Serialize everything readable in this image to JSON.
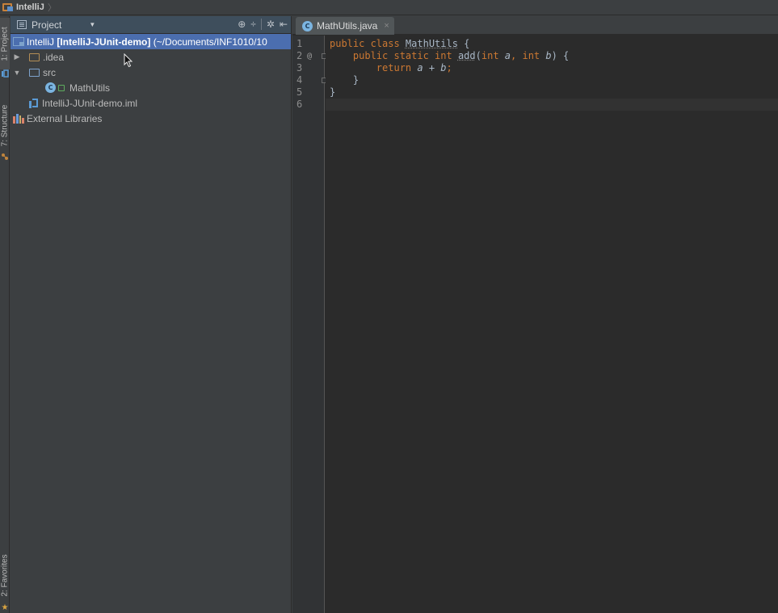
{
  "navbar": {
    "crumb": "IntelliJ"
  },
  "toolstrip": {
    "tab_project": "1: Project",
    "tab_structure": "7: Structure",
    "tab_favorites": "2: Favorites"
  },
  "project_panel": {
    "header_label": "Project",
    "tree": {
      "root_prefix": "IntelliJ ",
      "root_bold": "[IntelliJ-JUnit-demo]",
      "root_path": " (~/Documents/INF1010/10",
      "idea": ".idea",
      "src": "src",
      "mathutils": "MathUtils",
      "iml": "IntelliJ-JUnit-demo.iml",
      "ext_libs": "External Libraries"
    }
  },
  "editor": {
    "tab_label": "MathUtils.java",
    "tab_close": "×",
    "line_numbers": [
      "1",
      "2",
      "3",
      "4",
      "5",
      "6"
    ],
    "override_marker": "@",
    "code": {
      "l1_kw": "public class ",
      "l1_name": "MathUtils",
      "l1_brace": " {",
      "l2_indent": "    ",
      "l2_kw1": "public static int ",
      "l2_name": "add",
      "l2_open": "(",
      "l2_kw2": "int ",
      "l2_p1": "a",
      "l2_comma": ", ",
      "l2_kw3": "int ",
      "l2_p2": "b",
      "l2_close": ") {",
      "l3_indent": "        ",
      "l3_kw": "return ",
      "l3_a": "a",
      "l3_plus": " + ",
      "l3_b": "b",
      "l3_semi": ";",
      "l4": "    }",
      "l5": "}",
      "l6": ""
    }
  },
  "colors": {
    "selection": "#4b6eaf",
    "keyword": "#cc7832",
    "text": "#a9b7c6",
    "background": "#2b2b2b"
  }
}
